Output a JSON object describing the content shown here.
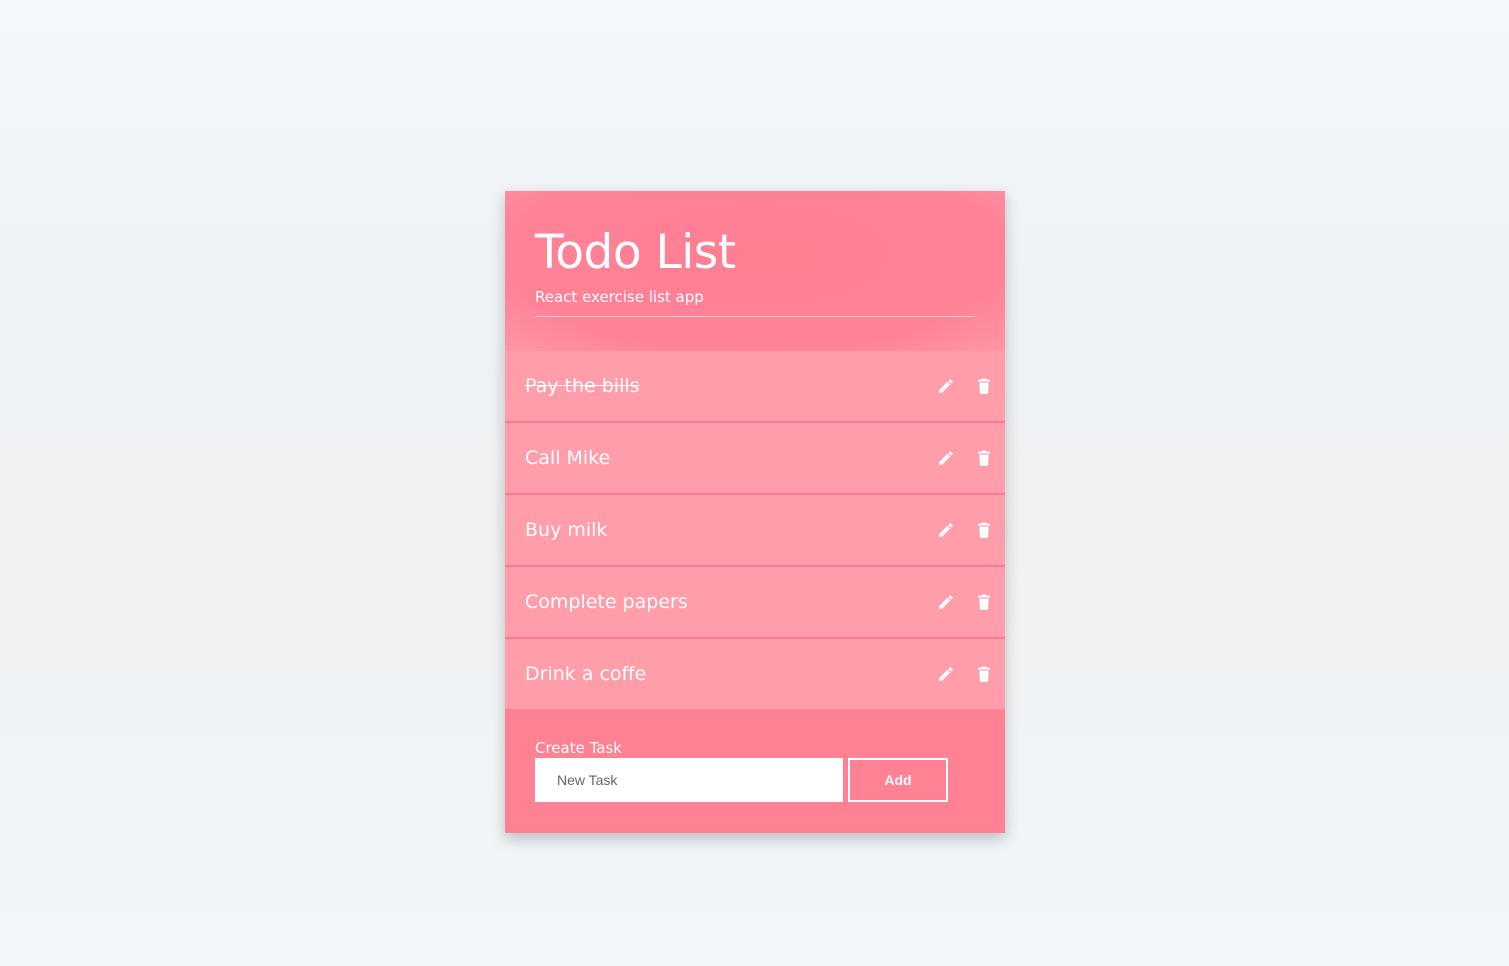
{
  "app": {
    "title": "Todo List",
    "subtitle": "React exercise list app"
  },
  "todos": [
    {
      "text": "Pay the bills",
      "completed": true
    },
    {
      "text": "Call Mike",
      "completed": false
    },
    {
      "text": "Buy milk",
      "completed": false
    },
    {
      "text": "Complete papers",
      "completed": false
    },
    {
      "text": "Drink a coffe",
      "completed": false
    }
  ],
  "item_actions": {
    "edit_icon": "pencil-icon",
    "delete_icon": "trash-icon"
  },
  "form": {
    "label": "Create Task",
    "placeholder": "New Task",
    "value": "",
    "add_label": "Add"
  },
  "colors": {
    "header_bg": "#ff8194",
    "item_bg": "#ff9daa",
    "item_divider": "#ff7a8f",
    "text": "#ffffff"
  }
}
